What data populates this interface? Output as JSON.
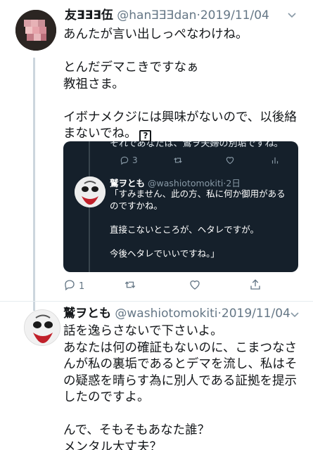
{
  "tweet1": {
    "name": "友ƎƎƎ伍",
    "handle": "@hanƎƎƎdan",
    "separator": "·",
    "date": "2019/11/04",
    "text": "あんたが言い出しっぺなわけね。\n\nとんだデマこきですなぁ\n教祖さま。\n\nイボナメクジには興味がないので、以後絡まないでね。",
    "unknown_glyph": "?",
    "quoted": {
      "cut_text": "それであなたは、鷲ヲ夫婦の別垢ですね。",
      "reply_count": "3",
      "name": "鷲ヲとも",
      "handle": "@washiotomokiti",
      "separator": "·",
      "date": "2日",
      "text": "「すみません、此の方、私に何か御用があるのですかね。\n\n直接こないところが、ヘタレですが。\n\n今後ヘタレでいいですね。」"
    },
    "actions": {
      "reply_count": "1"
    }
  },
  "tweet2": {
    "name": "鷲ヲとも",
    "handle": "@washiotomokiti",
    "separator": "·",
    "date": "2019/11/04",
    "text": "話を逸らさないで下さいよ。\nあなたは何の確証もないのに、こまつなさんが私の裏垢であるとデマを流し、私はその疑惑を晴らす為に別人である証拠を提示したのですよ。\n\nんで、そもそもあなた誰？\nメンタル大丈夫？"
  },
  "icons": {
    "chevron": "chevron-down-icon",
    "reply": "reply-icon",
    "retweet": "retweet-icon",
    "like": "heart-icon",
    "share": "share-icon"
  },
  "colors": {
    "thread_line": "#ccd6dd",
    "embed_bg": "#15202b",
    "muted": "#657786"
  }
}
